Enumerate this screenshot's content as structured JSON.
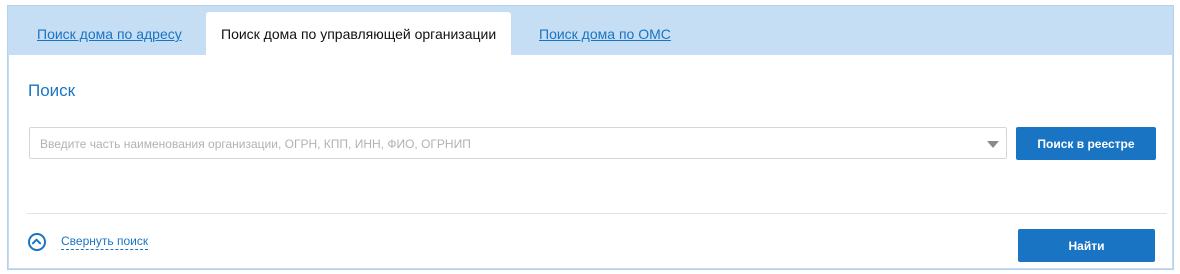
{
  "tabs": [
    {
      "label": "Поиск дома по адресу",
      "active": false
    },
    {
      "label": "Поиск дома по управляющей организации",
      "active": true
    },
    {
      "label": "Поиск дома по ОМС",
      "active": false
    }
  ],
  "panel": {
    "title": "Поиск",
    "search_placeholder": "Введите часть наименования организации, ОГРН, КПП, ИНН, ФИО, ОГРНИП",
    "registry_button": "Поиск в реестре",
    "collapse_label": "Свернуть поиск",
    "find_button": "Найти"
  },
  "icons": {
    "dropdown": "chevron-down-icon",
    "collapse": "chevron-up-circle-icon"
  },
  "colors": {
    "accent": "#1a74c4",
    "tab_bar": "#c6def3",
    "placeholder": "#b2b2b2"
  }
}
